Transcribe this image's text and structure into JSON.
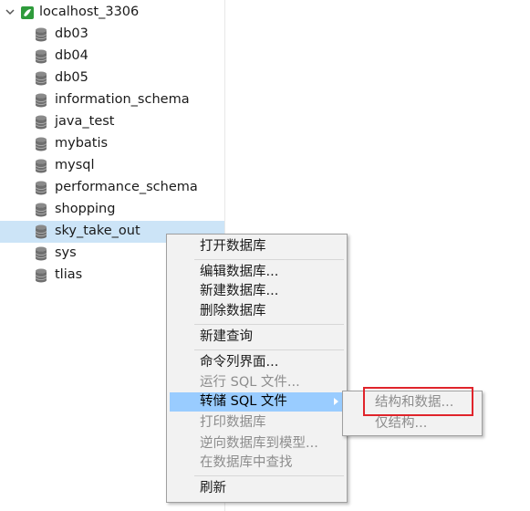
{
  "tree": {
    "connection": {
      "label": "localhost_3306",
      "icon": "mysql-connection-icon",
      "expanded": true
    },
    "databases": [
      {
        "label": "db03"
      },
      {
        "label": "db04"
      },
      {
        "label": "db05"
      },
      {
        "label": "information_schema"
      },
      {
        "label": "java_test"
      },
      {
        "label": "mybatis"
      },
      {
        "label": "mysql"
      },
      {
        "label": "performance_schema"
      },
      {
        "label": "shopping"
      },
      {
        "label": "sky_take_out",
        "selected": true
      },
      {
        "label": "sys"
      },
      {
        "label": "tlias"
      }
    ]
  },
  "context_menu": {
    "items": [
      {
        "label": "打开数据库",
        "enabled": true
      },
      {
        "label": "编辑数据库...",
        "enabled": true
      },
      {
        "label": "新建数据库...",
        "enabled": true
      },
      {
        "label": "删除数据库",
        "enabled": true
      },
      {
        "label": "新建查询",
        "enabled": true
      },
      {
        "label": "命令列界面...",
        "enabled": true
      },
      {
        "label": "运行 SQL 文件...",
        "enabled": false
      },
      {
        "label": "转储 SQL 文件",
        "enabled": true,
        "highlighted": true,
        "has_submenu": true
      },
      {
        "label": "打印数据库",
        "enabled": false
      },
      {
        "label": "逆向数据库到模型...",
        "enabled": false
      },
      {
        "label": "在数据库中查找",
        "enabled": false
      },
      {
        "label": "刷新",
        "enabled": true
      }
    ]
  },
  "submenu": {
    "items": [
      {
        "label": "结构和数据...",
        "enabled": false,
        "annotated": true
      },
      {
        "label": "仅结构...",
        "enabled": false
      }
    ]
  },
  "colors": {
    "selection": "#cce4f7",
    "menu_highlight": "#99ccff",
    "annotation": "#e0242b",
    "connection_icon": "#2e9b3b"
  }
}
